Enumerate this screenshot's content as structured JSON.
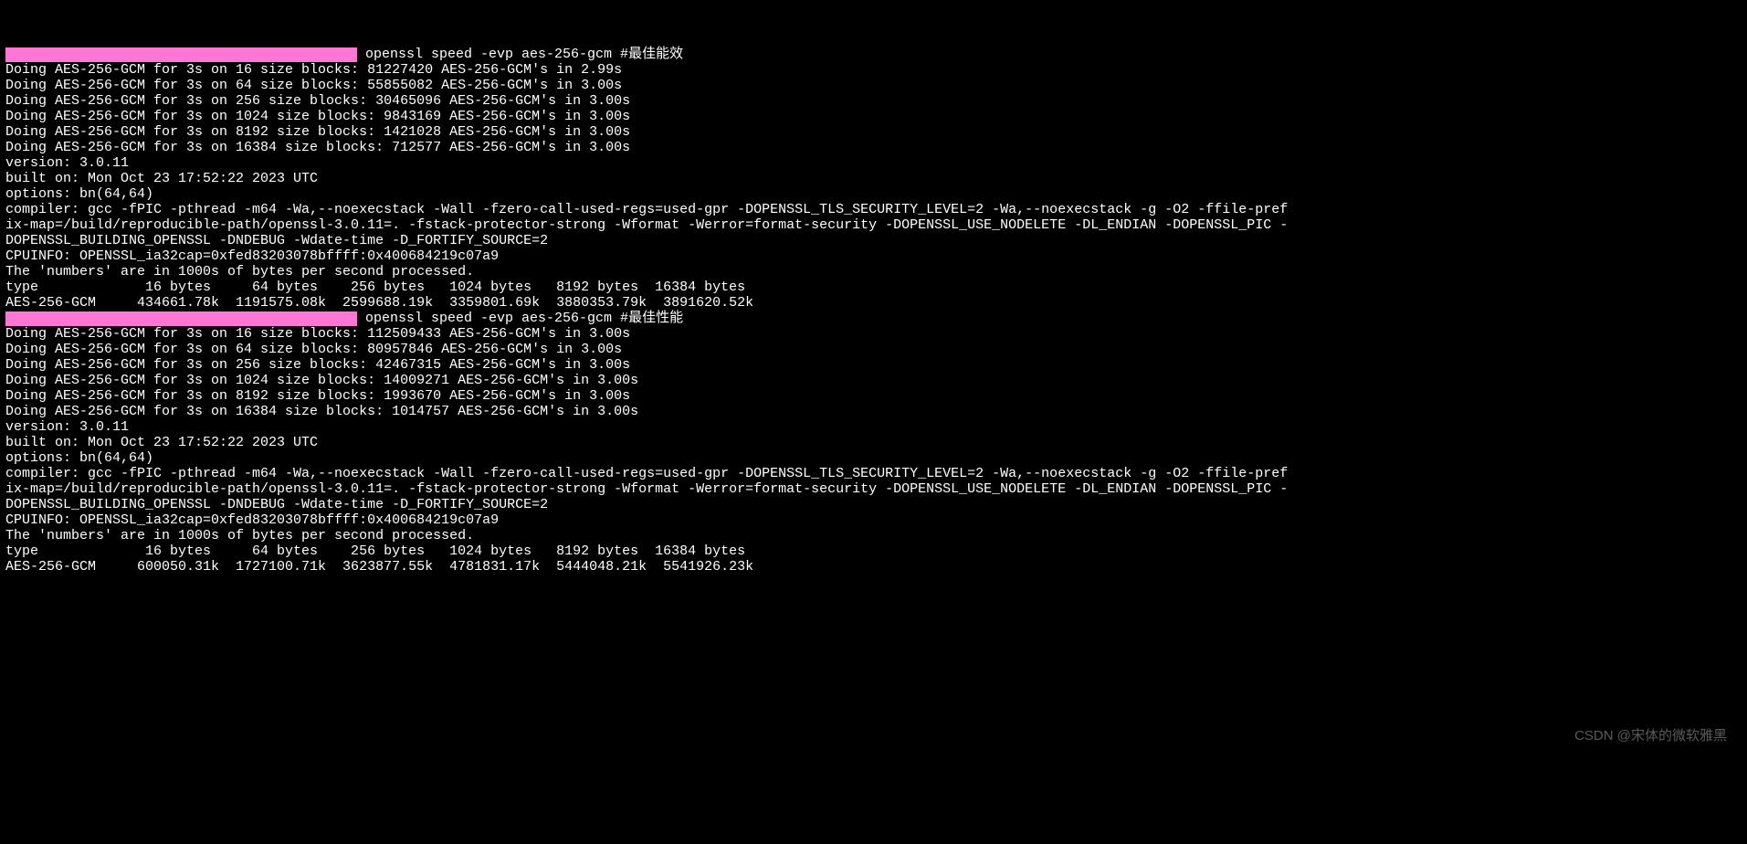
{
  "watermark": "CSDN @宋体的微软雅黑",
  "common": {
    "compiler1": "compiler: gcc -fPIC -pthread -m64 -Wa,--noexecstack -Wall -fzero-call-used-regs=used-gpr -DOPENSSL_TLS_SECURITY_LEVEL=2 -Wa,--noexecstack -g -O2 -ffile-pref",
    "compiler2": "ix-map=/build/reproducible-path/openssl-3.0.11=. -fstack-protector-strong -Wformat -Werror=format-security -DOPENSSL_USE_NODELETE -DL_ENDIAN -DOPENSSL_PIC -",
    "compiler3": "DOPENSSL_BUILDING_OPENSSL -DNDEBUG -Wdate-time -D_FORTIFY_SOURCE=2",
    "cpuinfo": "CPUINFO: OPENSSL_ia32cap=0xfed83203078bffff:0x400684219c07a9",
    "numbers_note": "The 'numbers' are in 1000s of bytes per second processed.",
    "table_header": "type             16 bytes     64 bytes    256 bytes   1024 bytes   8192 bytes  16384 bytes"
  },
  "run1": {
    "command": "openssl speed -evp aes-256-gcm #最佳能效",
    "doing": [
      "Doing AES-256-GCM for 3s on 16 size blocks: 81227420 AES-256-GCM's in 2.99s",
      "Doing AES-256-GCM for 3s on 64 size blocks: 55855082 AES-256-GCM's in 3.00s",
      "Doing AES-256-GCM for 3s on 256 size blocks: 30465096 AES-256-GCM's in 3.00s",
      "Doing AES-256-GCM for 3s on 1024 size blocks: 9843169 AES-256-GCM's in 3.00s",
      "Doing AES-256-GCM for 3s on 8192 size blocks: 1421028 AES-256-GCM's in 3.00s",
      "Doing AES-256-GCM for 3s on 16384 size blocks: 712577 AES-256-GCM's in 3.00s"
    ],
    "version": "version: 3.0.11",
    "built_on": "built on: Mon Oct 23 17:52:22 2023 UTC",
    "options": "options: bn(64,64)",
    "result_row": "AES-256-GCM     434661.78k  1191575.08k  2599688.19k  3359801.69k  3880353.79k  3891620.52k"
  },
  "run2": {
    "command": "openssl speed -evp aes-256-gcm #最佳性能",
    "doing": [
      "Doing AES-256-GCM for 3s on 16 size blocks: 112509433 AES-256-GCM's in 3.00s",
      "Doing AES-256-GCM for 3s on 64 size blocks: 80957846 AES-256-GCM's in 3.00s",
      "Doing AES-256-GCM for 3s on 256 size blocks: 42467315 AES-256-GCM's in 3.00s",
      "Doing AES-256-GCM for 3s on 1024 size blocks: 14009271 AES-256-GCM's in 3.00s",
      "Doing AES-256-GCM for 3s on 8192 size blocks: 1993670 AES-256-GCM's in 3.00s",
      "Doing AES-256-GCM for 3s on 16384 size blocks: 1014757 AES-256-GCM's in 3.00s"
    ],
    "version": "version: 3.0.11",
    "built_on": "built on: Mon Oct 23 17:52:22 2023 UTC",
    "options": "options: bn(64,64)",
    "result_row": "AES-256-GCM     600050.31k  1727100.71k  3623877.55k  4781831.17k  5444048.21k  5541926.23k"
  },
  "chart_data": {
    "type": "table",
    "title": "openssl speed -evp aes-256-gcm throughput (k = 1000s of bytes/sec)",
    "columns": [
      "16 bytes",
      "64 bytes",
      "256 bytes",
      "1024 bytes",
      "8192 bytes",
      "16384 bytes"
    ],
    "series": [
      {
        "name": "AES-256-GCM #最佳能效",
        "values": [
          434661.78,
          1191575.08,
          2599688.19,
          3359801.69,
          3880353.79,
          3891620.52
        ]
      },
      {
        "name": "AES-256-GCM #最佳性能",
        "values": [
          600050.31,
          1727100.71,
          3623877.55,
          4781831.17,
          5444048.21,
          5541926.23
        ]
      }
    ]
  }
}
